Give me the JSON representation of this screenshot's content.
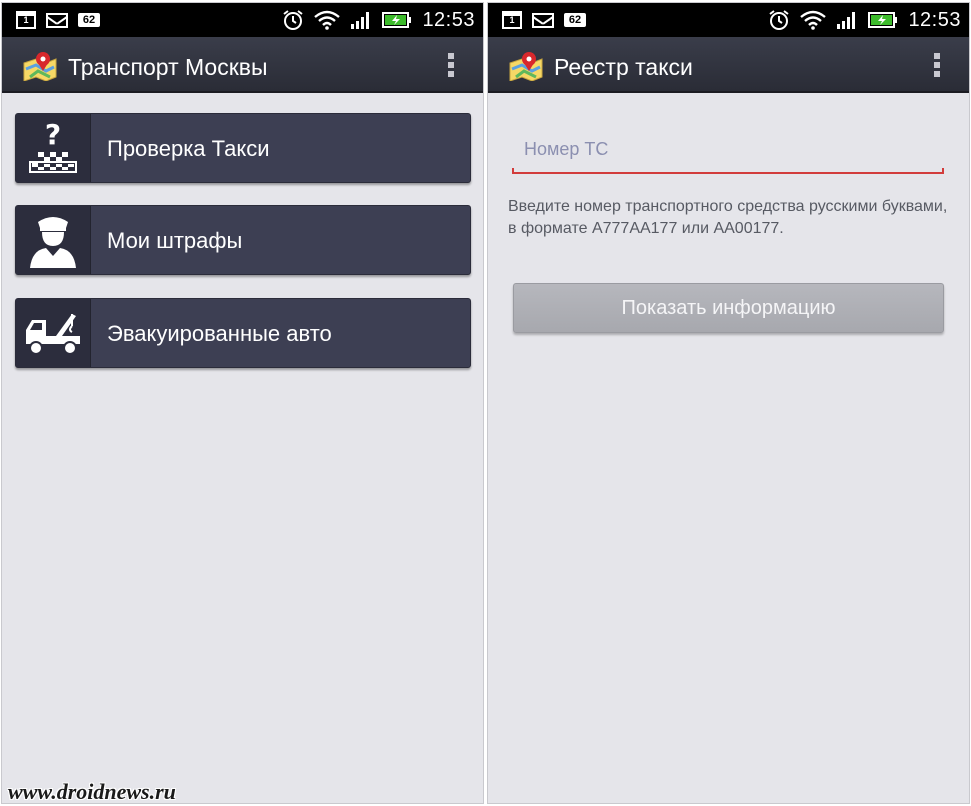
{
  "left": {
    "status": {
      "badge": "62",
      "calendar_day": "1",
      "time": "12:53"
    },
    "action_bar": {
      "title": "Транспорт Москвы"
    },
    "menu": [
      {
        "label": "Проверка Такси",
        "icon": "taxi-check-icon"
      },
      {
        "label": "Мои штрафы",
        "icon": "traffic-officer-icon"
      },
      {
        "label": "Эвакуированные авто",
        "icon": "tow-truck-icon"
      }
    ]
  },
  "right": {
    "status": {
      "badge": "62",
      "calendar_day": "1",
      "time": "12:53"
    },
    "action_bar": {
      "title": "Реестр такси"
    },
    "form": {
      "vehicle_number_placeholder": "Номер ТС",
      "vehicle_number_value": "",
      "hint": "Введите номер транспортного средства русскими буквами, в формате А777АА177 или АА00177.",
      "submit_label": "Показать информацию"
    }
  },
  "watermark": "www.droidnews.ru",
  "colors": {
    "action_bar": "#2f313d",
    "menu_button": "#3d3f53",
    "background": "#e5e5ea",
    "input_underline": "#d23c3c",
    "disabled_button": "#adaeb4",
    "battery": "#3dbb2c"
  }
}
